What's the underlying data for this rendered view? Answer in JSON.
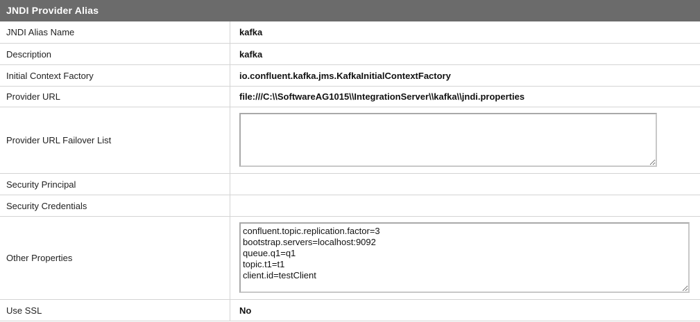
{
  "panel": {
    "title": "JNDI Provider Alias"
  },
  "rows": {
    "alias_name": {
      "label": "JNDI Alias Name",
      "value": "kafka"
    },
    "description": {
      "label": "Description",
      "value": "kafka"
    },
    "initial_context_factory": {
      "label": "Initial Context Factory",
      "value": "io.confluent.kafka.jms.KafkaInitialContextFactory"
    },
    "provider_url": {
      "label": "Provider URL",
      "value": "file:///C:\\\\SoftwareAG1015\\\\IntegrationServer\\\\kafka\\\\jndi.properties"
    },
    "provider_url_failover": {
      "label": "Provider URL Failover List",
      "value": ""
    },
    "security_principal": {
      "label": "Security Principal",
      "value": ""
    },
    "security_credentials": {
      "label": "Security Credentials",
      "value": ""
    },
    "other_properties": {
      "label": "Other Properties",
      "value": "confluent.topic.replication.factor=3\nbootstrap.servers=localhost:9092\nqueue.q1=q1\ntopic.t1=t1\nclient.id=testClient"
    },
    "use_ssl": {
      "label": "Use SSL",
      "value": "No"
    }
  }
}
